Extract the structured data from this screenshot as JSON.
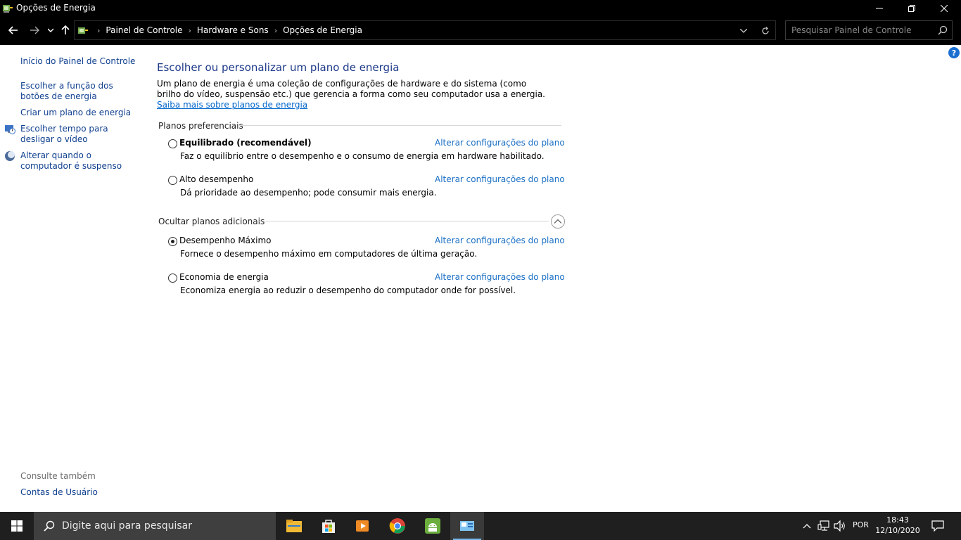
{
  "window": {
    "title": "Opções de Energia",
    "minimize_icon": "minimize-icon",
    "maximize_icon": "restore-icon",
    "close_icon": "close-icon"
  },
  "address": {
    "crumbs": [
      "Painel de Controle",
      "Hardware e Sons",
      "Opções de Energia"
    ],
    "search_placeholder": "Pesquisar Painel de Controle"
  },
  "sidebar": {
    "items": [
      {
        "label": "Início do Painel de Controle"
      },
      {
        "label": "Escolher a função dos botões de energia"
      },
      {
        "label": "Criar um plano de energia"
      },
      {
        "label": "Escolher tempo para desligar o vídeo",
        "icon": "monitor-clock-icon"
      },
      {
        "label": "Alterar quando o computador é suspenso",
        "icon": "moon-icon"
      }
    ],
    "see_also": "Consulte também",
    "see_also_link": "Contas de Usuário"
  },
  "main": {
    "title": "Escolher ou personalizar um plano de energia",
    "intro": "Um plano de energia é uma coleção de configurações de hardware e do sistema (como brilho do vídeo, suspensão etc.) que gerencia a forma como seu computador usa a energia. ",
    "intro_link": "Saiba mais sobre planos de energia",
    "preferred_header": "Planos preferenciais",
    "additional_header": "Ocultar planos adicionais",
    "change_link": "Alterar configurações do plano",
    "plans": [
      {
        "name": "Equilibrado (recomendável)",
        "desc": "Faz o equilíbrio entre o desempenho e o consumo de energia em hardware habilitado.",
        "selected": false
      },
      {
        "name": "Alto desempenho",
        "desc": "Dá prioridade ao desempenho; pode consumir mais energia.",
        "selected": false
      },
      {
        "name": "Desempenho Máximo",
        "desc": "Fornece o desempenho máximo em computadores de última geração.",
        "selected": true
      },
      {
        "name": "Economia de energia",
        "desc": "Economiza energia ao reduzir o desempenho do computador onde for possível.",
        "selected": false
      }
    ]
  },
  "taskbar": {
    "search_text": "Digite aqui para pesquisar",
    "apps": [
      "file-explorer-icon",
      "store-icon",
      "media-player-icon",
      "chrome-icon",
      "android-icon",
      "control-panel-icon"
    ],
    "language": "POR",
    "time": "18:43",
    "date": "12/10/2020"
  },
  "colors": {
    "accent": "#1a6fc4",
    "title": "#1e3a8a",
    "taskbar": "#1f1f1f"
  }
}
